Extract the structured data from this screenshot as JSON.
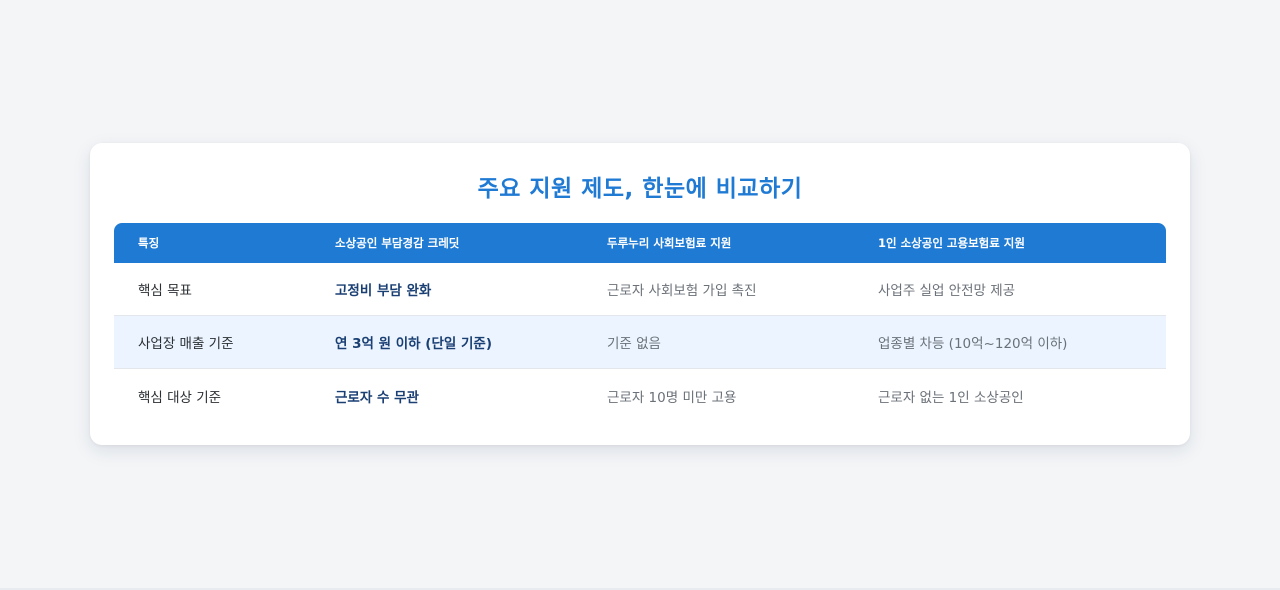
{
  "page": {
    "title": "주요 지원 제도, 한눈에 비교하기"
  },
  "table": {
    "headers": [
      "특징",
      "소상공인 부담경감 크레딧",
      "두루누리 사회보험료 지원",
      "1인 소상공인 고용보험료 지원"
    ],
    "rows": [
      [
        "핵심 목표",
        "고정비 부담 완화",
        "근로자 사회보험 가입 촉진",
        "사업주 실업 안전망 제공"
      ],
      [
        "사업장 매출 기준",
        "연 3억 원 이하 (단일 기준)",
        "기준 없음",
        "업종별 차등 (10억~120억 이하)"
      ],
      [
        "핵심 대상 기준",
        "근로자 수 무관",
        "근로자 10명 미만 고용",
        "근로자 없는 1인 소상공인"
      ]
    ]
  },
  "colors": {
    "accent": "#1f7ad4",
    "highlight_text": "#1a3f73",
    "alt_row": "#ecf5ff",
    "background": "#f3f5f7"
  }
}
